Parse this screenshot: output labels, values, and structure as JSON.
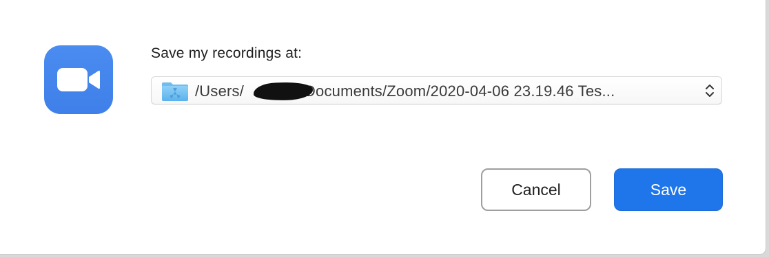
{
  "dialog": {
    "prompt": "Save my recordings at:",
    "app_icon": "zoom-video-camera-icon",
    "path_select": {
      "folder_icon": "folder-icon",
      "value": "/Users/██████r/Documents/Zoom/2020-04-06 23.19.46 Tes...",
      "value_prefix": "/Users/",
      "value_suffix": "r/Documents/Zoom/2020-04-06 23.19.46 Tes...",
      "stepper_icon": "up-down-chevron-icon"
    },
    "buttons": {
      "cancel": "Cancel",
      "save": "Save"
    }
  },
  "colors": {
    "accent": "#1f76ea",
    "app_icon_bg": "#4a8cf0"
  }
}
